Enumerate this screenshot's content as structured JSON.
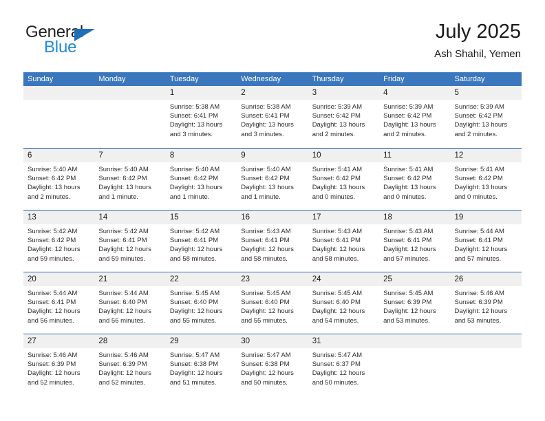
{
  "brand": {
    "name_top": "General",
    "name_bottom": "Blue",
    "triangle_color": "#1e6fb8",
    "blue_text_color": "#1e8bd5"
  },
  "header": {
    "title": "July 2025",
    "subtitle": "Ash Shahil, Yemen"
  },
  "theme": {
    "header_row_bg": "#3b77bc",
    "row_divider": "#2e6da8",
    "day_strip_bg": "#f0f0f0"
  },
  "weekdays": [
    "Sunday",
    "Monday",
    "Tuesday",
    "Wednesday",
    "Thursday",
    "Friday",
    "Saturday"
  ],
  "weeks": [
    [
      {
        "day": "",
        "lines": []
      },
      {
        "day": "",
        "lines": []
      },
      {
        "day": "1",
        "lines": [
          "Sunrise: 5:38 AM",
          "Sunset: 6:41 PM",
          "Daylight: 13 hours",
          "and 3 minutes."
        ]
      },
      {
        "day": "2",
        "lines": [
          "Sunrise: 5:38 AM",
          "Sunset: 6:41 PM",
          "Daylight: 13 hours",
          "and 3 minutes."
        ]
      },
      {
        "day": "3",
        "lines": [
          "Sunrise: 5:39 AM",
          "Sunset: 6:42 PM",
          "Daylight: 13 hours",
          "and 2 minutes."
        ]
      },
      {
        "day": "4",
        "lines": [
          "Sunrise: 5:39 AM",
          "Sunset: 6:42 PM",
          "Daylight: 13 hours",
          "and 2 minutes."
        ]
      },
      {
        "day": "5",
        "lines": [
          "Sunrise: 5:39 AM",
          "Sunset: 6:42 PM",
          "Daylight: 13 hours",
          "and 2 minutes."
        ]
      }
    ],
    [
      {
        "day": "6",
        "lines": [
          "Sunrise: 5:40 AM",
          "Sunset: 6:42 PM",
          "Daylight: 13 hours",
          "and 2 minutes."
        ]
      },
      {
        "day": "7",
        "lines": [
          "Sunrise: 5:40 AM",
          "Sunset: 6:42 PM",
          "Daylight: 13 hours",
          "and 1 minute."
        ]
      },
      {
        "day": "8",
        "lines": [
          "Sunrise: 5:40 AM",
          "Sunset: 6:42 PM",
          "Daylight: 13 hours",
          "and 1 minute."
        ]
      },
      {
        "day": "9",
        "lines": [
          "Sunrise: 5:40 AM",
          "Sunset: 6:42 PM",
          "Daylight: 13 hours",
          "and 1 minute."
        ]
      },
      {
        "day": "10",
        "lines": [
          "Sunrise: 5:41 AM",
          "Sunset: 6:42 PM",
          "Daylight: 13 hours",
          "and 0 minutes."
        ]
      },
      {
        "day": "11",
        "lines": [
          "Sunrise: 5:41 AM",
          "Sunset: 6:42 PM",
          "Daylight: 13 hours",
          "and 0 minutes."
        ]
      },
      {
        "day": "12",
        "lines": [
          "Sunrise: 5:41 AM",
          "Sunset: 6:42 PM",
          "Daylight: 13 hours",
          "and 0 minutes."
        ]
      }
    ],
    [
      {
        "day": "13",
        "lines": [
          "Sunrise: 5:42 AM",
          "Sunset: 6:42 PM",
          "Daylight: 12 hours",
          "and 59 minutes."
        ]
      },
      {
        "day": "14",
        "lines": [
          "Sunrise: 5:42 AM",
          "Sunset: 6:41 PM",
          "Daylight: 12 hours",
          "and 59 minutes."
        ]
      },
      {
        "day": "15",
        "lines": [
          "Sunrise: 5:42 AM",
          "Sunset: 6:41 PM",
          "Daylight: 12 hours",
          "and 58 minutes."
        ]
      },
      {
        "day": "16",
        "lines": [
          "Sunrise: 5:43 AM",
          "Sunset: 6:41 PM",
          "Daylight: 12 hours",
          "and 58 minutes."
        ]
      },
      {
        "day": "17",
        "lines": [
          "Sunrise: 5:43 AM",
          "Sunset: 6:41 PM",
          "Daylight: 12 hours",
          "and 58 minutes."
        ]
      },
      {
        "day": "18",
        "lines": [
          "Sunrise: 5:43 AM",
          "Sunset: 6:41 PM",
          "Daylight: 12 hours",
          "and 57 minutes."
        ]
      },
      {
        "day": "19",
        "lines": [
          "Sunrise: 5:44 AM",
          "Sunset: 6:41 PM",
          "Daylight: 12 hours",
          "and 57 minutes."
        ]
      }
    ],
    [
      {
        "day": "20",
        "lines": [
          "Sunrise: 5:44 AM",
          "Sunset: 6:41 PM",
          "Daylight: 12 hours",
          "and 56 minutes."
        ]
      },
      {
        "day": "21",
        "lines": [
          "Sunrise: 5:44 AM",
          "Sunset: 6:40 PM",
          "Daylight: 12 hours",
          "and 56 minutes."
        ]
      },
      {
        "day": "22",
        "lines": [
          "Sunrise: 5:45 AM",
          "Sunset: 6:40 PM",
          "Daylight: 12 hours",
          "and 55 minutes."
        ]
      },
      {
        "day": "23",
        "lines": [
          "Sunrise: 5:45 AM",
          "Sunset: 6:40 PM",
          "Daylight: 12 hours",
          "and 55 minutes."
        ]
      },
      {
        "day": "24",
        "lines": [
          "Sunrise: 5:45 AM",
          "Sunset: 6:40 PM",
          "Daylight: 12 hours",
          "and 54 minutes."
        ]
      },
      {
        "day": "25",
        "lines": [
          "Sunrise: 5:45 AM",
          "Sunset: 6:39 PM",
          "Daylight: 12 hours",
          "and 53 minutes."
        ]
      },
      {
        "day": "26",
        "lines": [
          "Sunrise: 5:46 AM",
          "Sunset: 6:39 PM",
          "Daylight: 12 hours",
          "and 53 minutes."
        ]
      }
    ],
    [
      {
        "day": "27",
        "lines": [
          "Sunrise: 5:46 AM",
          "Sunset: 6:39 PM",
          "Daylight: 12 hours",
          "and 52 minutes."
        ]
      },
      {
        "day": "28",
        "lines": [
          "Sunrise: 5:46 AM",
          "Sunset: 6:39 PM",
          "Daylight: 12 hours",
          "and 52 minutes."
        ]
      },
      {
        "day": "29",
        "lines": [
          "Sunrise: 5:47 AM",
          "Sunset: 6:38 PM",
          "Daylight: 12 hours",
          "and 51 minutes."
        ]
      },
      {
        "day": "30",
        "lines": [
          "Sunrise: 5:47 AM",
          "Sunset: 6:38 PM",
          "Daylight: 12 hours",
          "and 50 minutes."
        ]
      },
      {
        "day": "31",
        "lines": [
          "Sunrise: 5:47 AM",
          "Sunset: 6:37 PM",
          "Daylight: 12 hours",
          "and 50 minutes."
        ]
      },
      {
        "day": "",
        "lines": []
      },
      {
        "day": "",
        "lines": []
      }
    ]
  ]
}
